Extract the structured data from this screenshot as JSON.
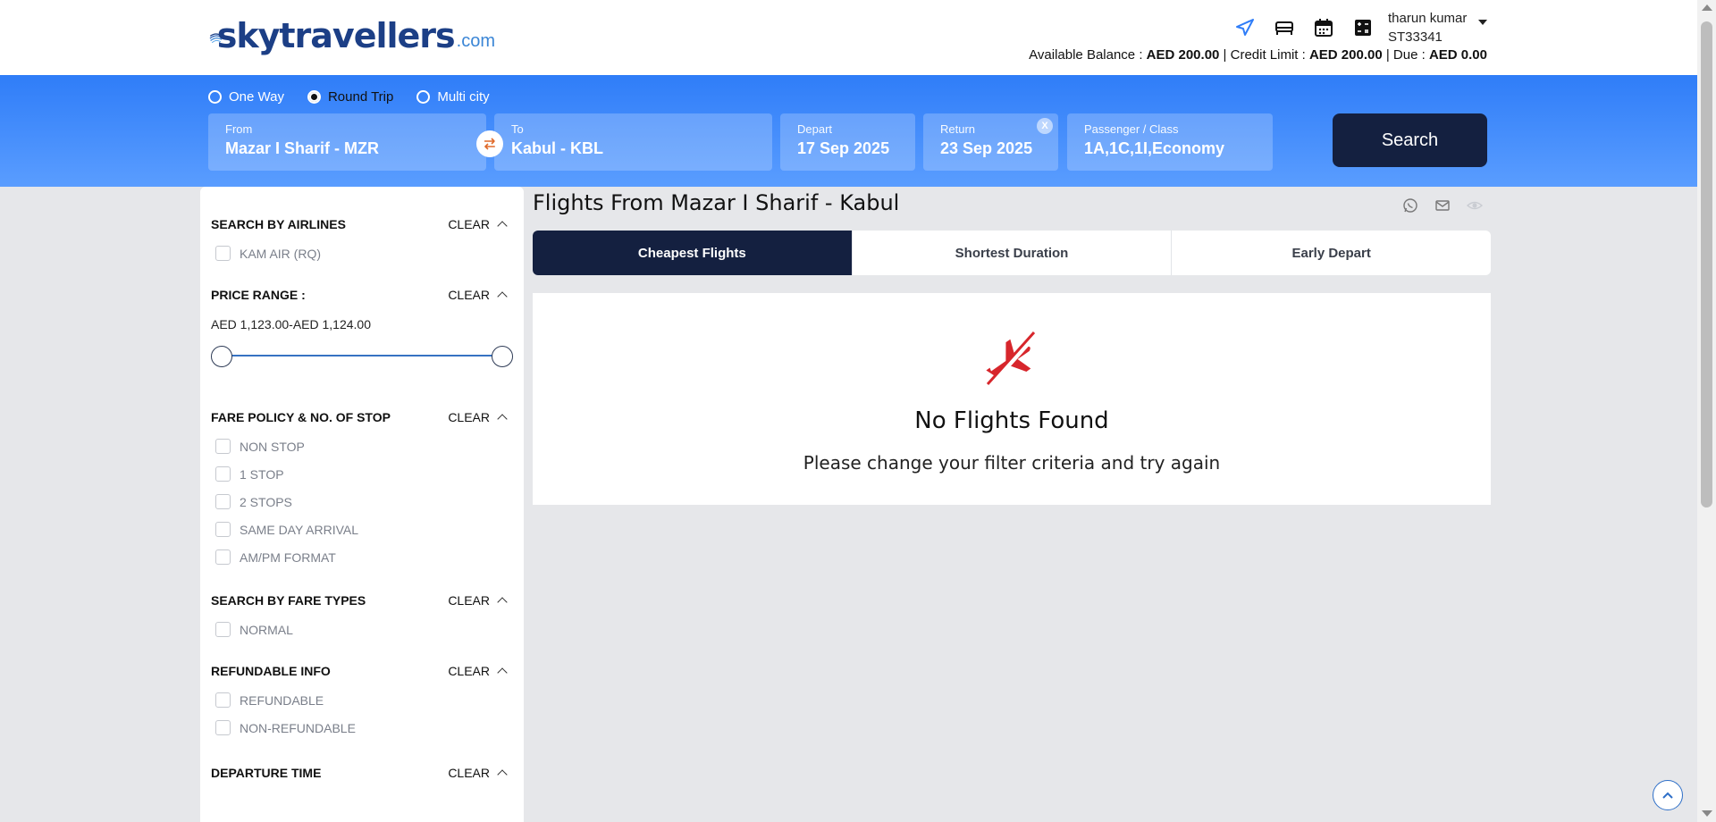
{
  "brand": {
    "name": "skytravellers",
    "suffix": ".com"
  },
  "header": {
    "icons": [
      "flight-icon",
      "hotel-icon",
      "calendar-icon",
      "calculator-icon"
    ],
    "user_name": "tharun kumar",
    "user_id": "ST33341",
    "balance_label": "Available Balance :",
    "balance_value": "AED 200.00",
    "credit_label": "| Credit Limit :",
    "credit_value": "AED 200.00",
    "due_label": "| Due :",
    "due_value": "AED 0.00"
  },
  "search": {
    "trip_types": [
      "One Way",
      "Round Trip",
      "Multi city"
    ],
    "selected_trip": "Round Trip",
    "from_label": "From",
    "from_value": "Mazar I Sharif - MZR",
    "to_label": "To",
    "to_value": "Kabul - KBL",
    "depart_label": "Depart",
    "depart_value": "17 Sep 2025",
    "return_label": "Return",
    "return_value": "23 Sep 2025",
    "return_clear": "X",
    "pax_label": "Passenger / Class",
    "pax_value": "1A,1C,1I,Economy",
    "button": "Search"
  },
  "filters": {
    "clear": "CLEAR",
    "airlines": {
      "title": "SEARCH BY AIRLINES",
      "options": [
        "KAM AIR (RQ)"
      ]
    },
    "price": {
      "title": "PRICE RANGE :",
      "range_text": "AED 1,123.00-AED 1,124.00",
      "min": 1123.0,
      "max": 1124.0
    },
    "stops": {
      "title": "FARE POLICY & NO. OF STOP",
      "options": [
        "NON STOP",
        "1 STOP",
        "2 STOPS",
        "SAME DAY ARRIVAL",
        "AM/PM FORMAT"
      ]
    },
    "fare_types": {
      "title": "SEARCH BY FARE TYPES",
      "options": [
        "NORMAL"
      ]
    },
    "refundable": {
      "title": "REFUNDABLE INFO",
      "options": [
        "REFUNDABLE",
        "NON-REFUNDABLE"
      ]
    },
    "departure": {
      "title": "DEPARTURE TIME"
    }
  },
  "results": {
    "title": "Flights From Mazar I Sharif - Kabul",
    "tabs": [
      "Cheapest Flights",
      "Shortest Duration",
      "Early Depart"
    ],
    "active_tab": "Cheapest Flights",
    "empty_title": "No Flights Found",
    "empty_subtitle": "Please change your filter criteria and try again"
  },
  "colors": {
    "banner": "#3c87fb",
    "navy": "#142040",
    "no_flight_red": "#d7262c"
  }
}
